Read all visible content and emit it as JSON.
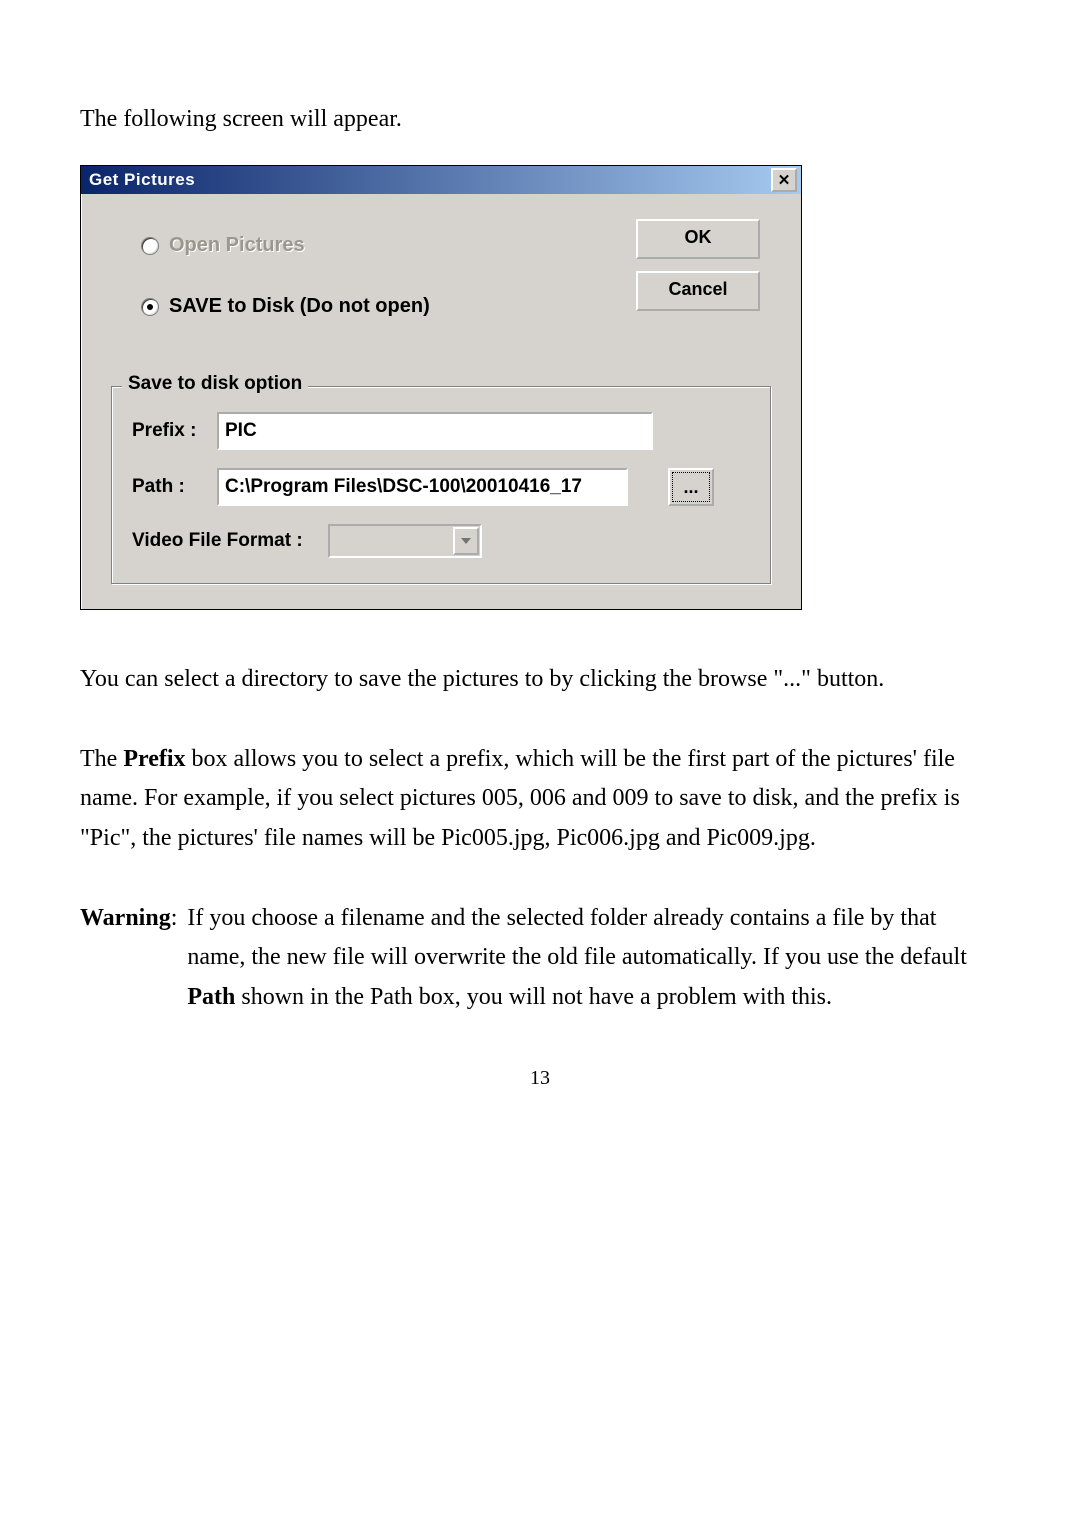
{
  "intro_text": "The following screen will appear.",
  "dialog": {
    "title": "Get Pictures",
    "close_glyph": "✕",
    "radio_open": "Open Pictures",
    "radio_save": "SAVE to Disk (Do not open)",
    "ok_label": "OK",
    "cancel_label": "Cancel",
    "group_legend": "Save to disk option",
    "prefix_label": "Prefix :",
    "prefix_value": "PIC",
    "path_label": "Path :",
    "path_value": "C:\\Program Files\\DSC-100\\20010416_17",
    "browse_label": "...",
    "vff_label": "Video File Format :",
    "vff_value": ""
  },
  "para1": "You can select a directory to save the pictures to by clicking the browse \"...\" button.",
  "para2_a": "The ",
  "para2_bold": "Prefix",
  "para2_b": " box allows you to select a prefix, which will be the first part of the pictures' file name. For example, if you select pictures 005, 006 and 009 to save to disk, and the prefix is \"Pic\", the pictures' file names will be Pic005.jpg, Pic006.jpg and Pic009.jpg.",
  "warning_label": "Warning",
  "warning_colon": ":",
  "warning_a": "If you choose a filename and the selected folder already contains a file by that name, the new file will overwrite the old file automatically. If you use the default ",
  "warning_bold": "Path",
  "warning_b": " shown in the Path box, you will not have a problem with this.",
  "page_number": "13"
}
